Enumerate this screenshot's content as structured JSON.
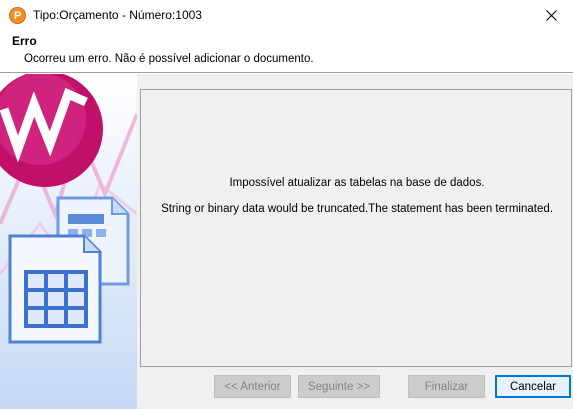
{
  "window": {
    "app_icon_letter": "P",
    "title": "Tipo:Orçamento - Número:1003"
  },
  "header": {
    "title": "Erro",
    "description": "Ocorreu um erro. Não é possível adicionar o documento."
  },
  "content": {
    "message_line1": "Impossível atualizar as tabelas na base de dados.",
    "message_line2": "String or binary data would be truncated.The statement has been terminated."
  },
  "buttons": {
    "back": "<< Anterior",
    "next": "Seguinte >>",
    "finish": "Finalizar",
    "cancel": "Cancelar"
  },
  "colors": {
    "accent": "#0078d7",
    "app_icon": "#f0902a",
    "wizard_logo": "#c0106a"
  }
}
